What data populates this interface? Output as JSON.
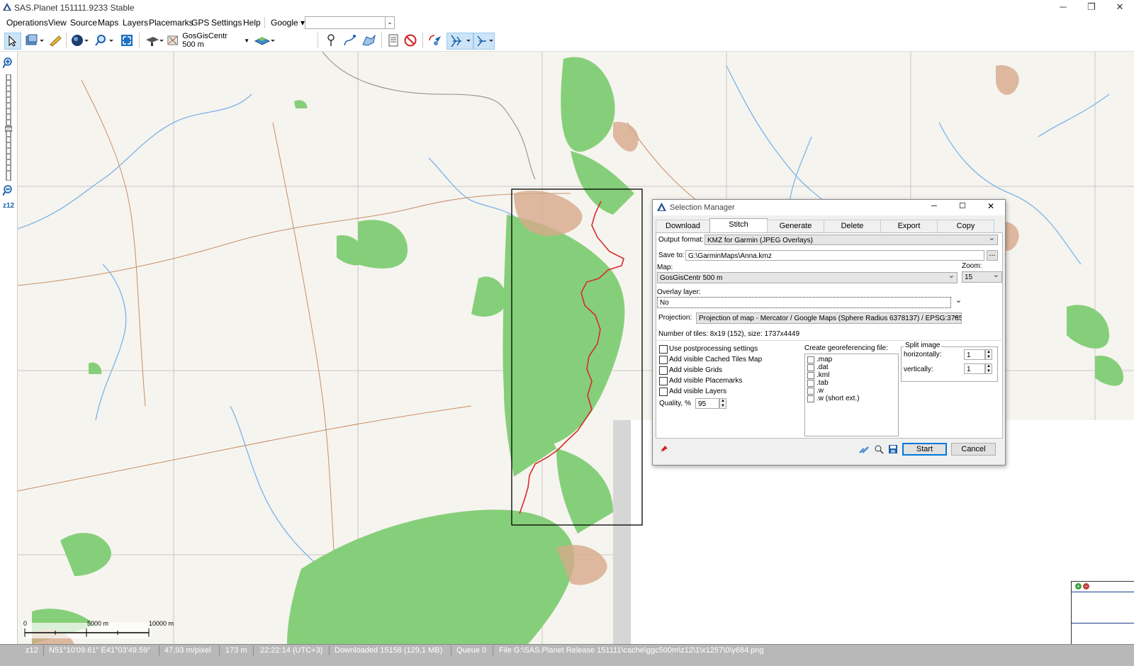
{
  "window": {
    "title": "SAS.Planet 151111.9233 Stable",
    "minimize": "─",
    "maximize": "❐",
    "close": "✕"
  },
  "menu": {
    "items": [
      "Operations",
      "View",
      "Source",
      "Maps",
      "Layers",
      "Placemarks",
      "GPS",
      "Settings",
      "Help"
    ],
    "search_provider": "Google",
    "search_value": ""
  },
  "toolbar": {
    "map_name": "GosGisCentr 500 m"
  },
  "leftbar": {
    "zoom_label": "z12"
  },
  "map": {
    "scale_0": "0",
    "scale_mid": "5000 m",
    "scale_end": "10000 m"
  },
  "status": {
    "zoom": "z12",
    "coords": "N51°10'09.61\" E41°03'49.59\"",
    "resolution": "47,93 m/pixel",
    "distance": "173 m",
    "time": "22:22:14 (UTC+3)",
    "downloaded": "Downloaded 15158 (129,1 MB)",
    "queue": "Queue 0",
    "file": "File G:\\SAS.Planet Release 151111\\cache\\ggc500m\\z12\\1\\x1257\\0\\y684.png"
  },
  "dialog": {
    "title": "Selection Manager",
    "tabs": [
      "Download",
      "Stitch",
      "Generate",
      "Delete",
      "Export",
      "Copy"
    ],
    "active_tab": "Stitch",
    "output_format_label": "Output format:",
    "output_format_value": "KMZ for Garmin (JPEG Overlays)",
    "save_to_label": "Save to:",
    "save_to_value": "G:\\GarminMaps\\Anna.kmz",
    "browse": "...",
    "map_label": "Map:",
    "map_value": "GosGisCentr 500 m",
    "zoom_label": "Zoom:",
    "zoom_value": "15",
    "overlay_label": "Overlay layer:",
    "overlay_value": "No",
    "projection_label": "Projection:",
    "projection_value": "Projection of map - Mercator / Google Maps (Sphere Radius 6378137) / EPSG:3785",
    "tiles_info": "Number of tiles: 8x19 (152), size: 1737x4449",
    "options": [
      "Use postprocessing settings",
      "Add visible Cached Tiles Map",
      "Add visible Grids",
      "Add visible Placemarks",
      "Add visible Layers"
    ],
    "quality_label": "Quality, %",
    "quality_value": "95",
    "georef_label": "Create georeferencing file:",
    "georef_options": [
      ".map",
      ".dat",
      ".kml",
      ".tab",
      ".w",
      ".w (short ext.)"
    ],
    "split_label": "Split image",
    "split_h_label": "horizontally:",
    "split_h_value": "1",
    "split_v_label": "vertically:",
    "split_v_value": "1",
    "start": "Start",
    "cancel": "Cancel"
  }
}
